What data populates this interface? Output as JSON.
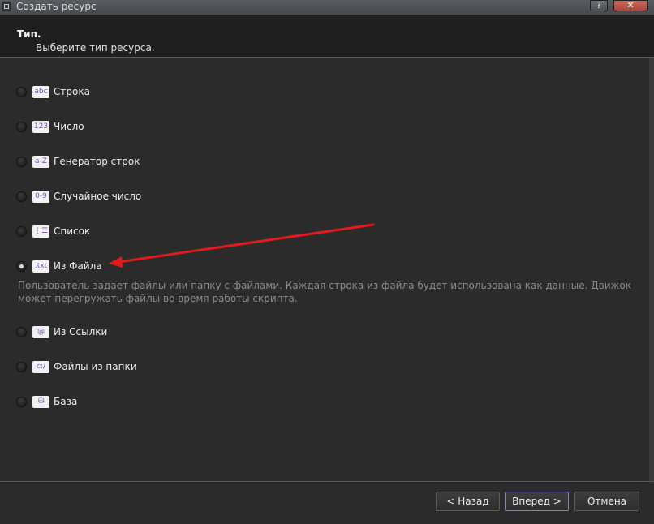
{
  "window": {
    "title": "Создать ресурс",
    "help_label": "?",
    "close_label": "✕"
  },
  "header": {
    "title": "Тип.",
    "subtitle": "Выберите тип ресурса."
  },
  "options": [
    {
      "label": "Строка",
      "icon_text": "abc",
      "icon": "abc-icon",
      "checked": false
    },
    {
      "label": "Число",
      "icon_text": "123",
      "icon": "number-icon",
      "checked": false
    },
    {
      "label": "Генератор строк",
      "icon_text": "a-Z",
      "icon": "string-generator-icon",
      "checked": false
    },
    {
      "label": "Случайное число",
      "icon_text": "0-9",
      "icon": "random-number-icon",
      "checked": false
    },
    {
      "label": "Список",
      "icon_text": "⋮☰",
      "icon": "list-icon",
      "checked": false
    },
    {
      "label": "Из Файла",
      "icon_text": ".txt",
      "icon": "file-icon",
      "checked": true
    },
    {
      "label": "Из Ссылки",
      "icon_text": "@",
      "icon": "link-icon",
      "checked": false
    },
    {
      "label": "Файлы из папки",
      "icon_text": "c:/",
      "icon": "folder-icon",
      "checked": false
    },
    {
      "label": "База",
      "icon_text": "⛁",
      "icon": "database-icon",
      "checked": false
    }
  ],
  "selected_description": "Пользователь задает файлы или папку с файлами. Каждая строка из файла будет использована как данные. Движок может перегружать файлы во время работы скрипта.",
  "footer": {
    "back_label": "< Назад",
    "next_label": "Вперед >",
    "cancel_label": "Отмена"
  },
  "colors": {
    "annotation_arrow": "#e01b1b",
    "icon_text": "#7a4fb0",
    "accent_border": "#8c7ec4"
  }
}
